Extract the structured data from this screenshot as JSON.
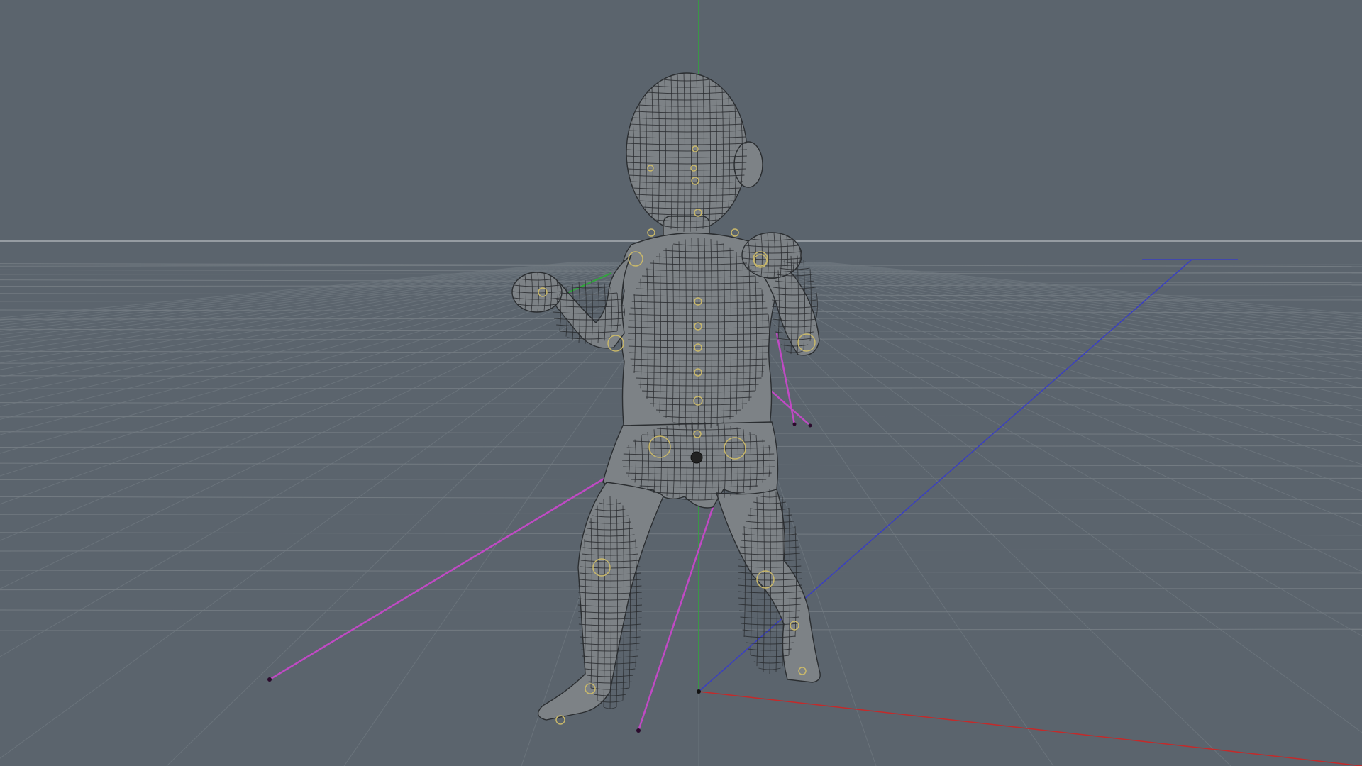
{
  "viewport": {
    "name": "3d-perspective-viewport",
    "background": "#5b646d",
    "horizon_color": "#a9aeb3"
  },
  "axes": {
    "x_color": "#c42a2a",
    "y_color": "#2fa83a",
    "z_color": "#3a3fc0"
  },
  "rig": {
    "ik_color": "#c04ac4",
    "joint_color": "#c9b86a",
    "mesh_color": "#7d8286"
  },
  "icons": {
    "world-origin": "axis-origin-icon"
  }
}
